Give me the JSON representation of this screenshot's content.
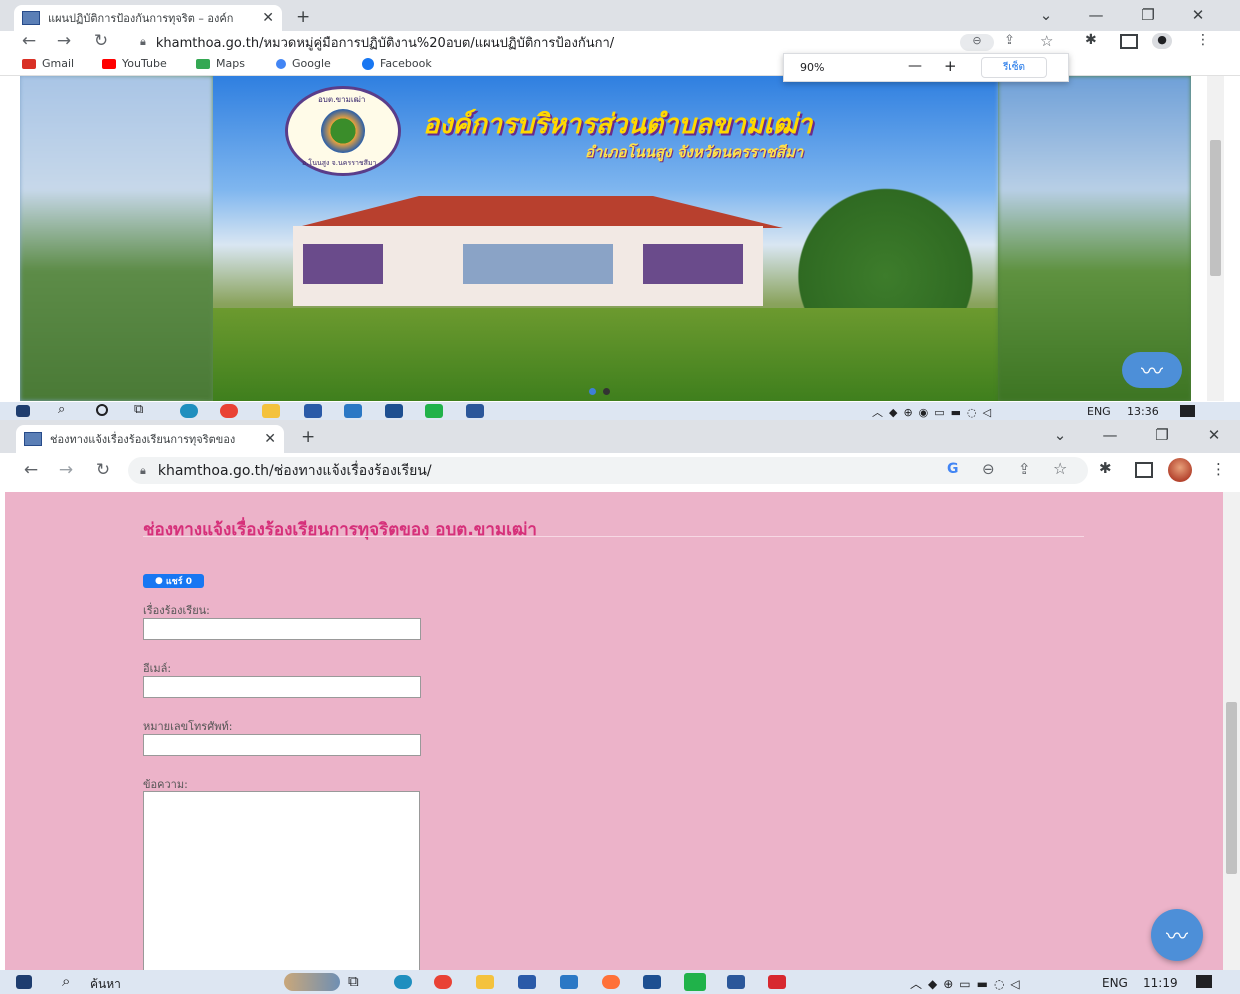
{
  "top_window": {
    "tab_title": "แผนปฏิบัติการป้องกันการทุจริต – องค์ก",
    "url": "khamthoa.go.th/หมวดหมู่คู่มือการปฏิบัติงาน%20อบต/แผนปฏิบัติการป้องกันกา/",
    "bookmarks": [
      {
        "label": "Gmail",
        "color": "#d93025"
      },
      {
        "label": "YouTube",
        "color": "#ff0000"
      },
      {
        "label": "Maps",
        "color": "#34a853"
      },
      {
        "label": "Google",
        "color": "#4285f4"
      },
      {
        "label": "Facebook",
        "color": "#1877f2"
      }
    ],
    "zoom_popup": {
      "value": "90%",
      "minus": "—",
      "plus": "+",
      "reset": "รีเซ็ต"
    },
    "banner": {
      "org_name": "องค์การบริหารส่วนตำบลขามเฒ่า",
      "district": "อำเภอโนนสูง จังหวัดนครราชสีมา",
      "seal_top": "อบต.ขามเฒ่า",
      "seal_bottom": "อ.โนนสูง จ.นครราชสีมา"
    },
    "taskbar": {
      "lang": "ENG",
      "time": "13:36"
    }
  },
  "bottom_window": {
    "tab_title": "ช่องทางแจ้งเรื่องร้องเรียนการทุจริตของ",
    "url": "khamthoa.go.th/ช่องทางแจ้งเรื่องร้องเรียน/",
    "page_title": "ช่องทางแจ้งเรื่องร้องเรียนการทุจริตของ อบต.ขามเฒ่า",
    "share_button": "แชร์ 0",
    "fields": [
      {
        "label": "เรื่องร้องเรียน:",
        "value": ""
      },
      {
        "label": "อีเมล์:",
        "value": ""
      },
      {
        "label": "หมายเลขโทรศัพท์:",
        "value": ""
      },
      {
        "label": "ข้อความ:",
        "value": ""
      }
    ],
    "taskbar": {
      "search_placeholder": "ค้นหา",
      "lang": "ENG",
      "time": "11:19"
    }
  },
  "colors": {
    "page_bg": "#ecb3c9",
    "title": "#d6307a",
    "chrome_bg": "#dee1e6",
    "taskbar": "#dde6f2"
  }
}
